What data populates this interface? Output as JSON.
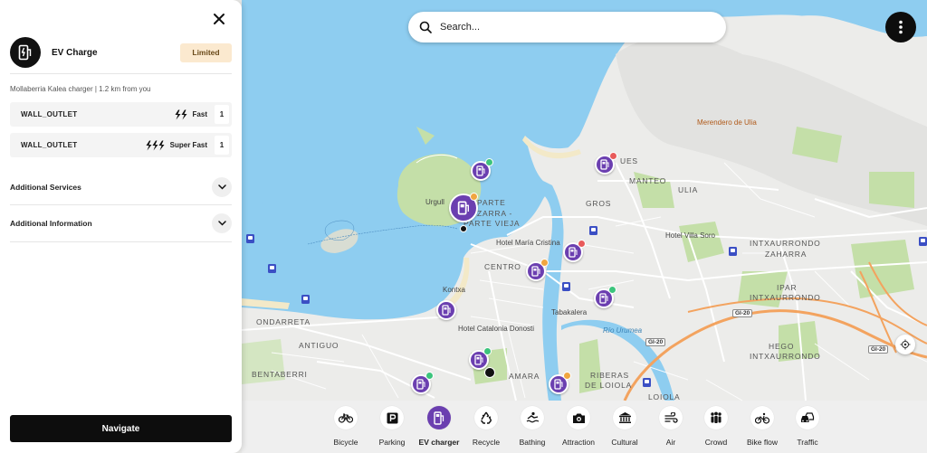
{
  "panel": {
    "title": "EV Charge",
    "status_badge": "Limited",
    "location_subtitle": "Mollaberria Kalea charger  | 1.2 km from you",
    "connectors": [
      {
        "type": "WALL_OUTLET",
        "speed": "Fast",
        "count": "1",
        "bolts": 2
      },
      {
        "type": "WALL_OUTLET",
        "speed": "Super Fast",
        "count": "1",
        "bolts": 3
      }
    ],
    "sections": [
      {
        "label": "Additional Services"
      },
      {
        "label": "Additional Information"
      }
    ],
    "navigate_label": "Navigate"
  },
  "search": {
    "placeholder": "Search...",
    "value": ""
  },
  "categories": [
    {
      "label": "Bicycle",
      "icon": "bicycle-icon",
      "active": false
    },
    {
      "label": "Parking",
      "icon": "parking-icon",
      "active": false
    },
    {
      "label": "EV charger",
      "icon": "ev-charger-icon",
      "active": true
    },
    {
      "label": "Recycle",
      "icon": "recycle-icon",
      "active": false
    },
    {
      "label": "Bathing",
      "icon": "bathing-icon",
      "active": false
    },
    {
      "label": "Attraction",
      "icon": "camera-icon",
      "active": false
    },
    {
      "label": "Cultural",
      "icon": "museum-icon",
      "active": false
    },
    {
      "label": "Air",
      "icon": "wind-icon",
      "active": false
    },
    {
      "label": "Crowd",
      "icon": "crowd-icon",
      "active": false
    },
    {
      "label": "Bike flow",
      "icon": "bike-flow-icon",
      "active": false
    },
    {
      "label": "Traffic",
      "icon": "traffic-icon",
      "active": false
    }
  ],
  "map": {
    "labels": {
      "merendero": "Merendero de Ulia",
      "ues": "UES",
      "manteo": "MANTEO",
      "ulia": "ULIA",
      "gros": "GROS",
      "urgull": "Urgull",
      "parte_vieja_1": "PARTE",
      "parte_vieja_2": "ZARRA -",
      "parte_vieja_3": "PARTE VIEJA",
      "hotel_maria_cristina": "Hotel María Cristina",
      "hotel_villa_soro": "Hotel Villa Soro",
      "intxaurrondo_zaharra_1": "INTXAURRONDO",
      "intxaurrondo_zaharra_2": "ZAHARRA",
      "centro": "CENTRO",
      "ipar_1": "IPAR",
      "ipar_2": "INTXAURRONDO",
      "kontxa": "Kontxa",
      "tabakalera": "Tabakalera",
      "hotel_catalonia": "Hotel Catalonia Donosti",
      "rio_urumea": "Río Urumea",
      "ondarreta": "ONDARRETA",
      "antiguo": "ANTIGUO",
      "hego_1": "HEGO",
      "hego_2": "INTXAURRONDO",
      "bentaberri": "BENTABERRI",
      "amara": "AMARA",
      "riberas_1": "RIBERAS",
      "riberas_2": "DE LOIOLA",
      "loiola": "LOIOLA",
      "gi20_a": "GI-20",
      "gi20_b": "GI-20",
      "gi20_c": "GI-20"
    }
  },
  "colors": {
    "accent": "#6b3fb0",
    "water": "#8ecdf0",
    "park": "#c4dfa8",
    "land": "#ececea",
    "limited_bg": "#fbe9cf",
    "navigate_bg": "#0d0d0d"
  }
}
